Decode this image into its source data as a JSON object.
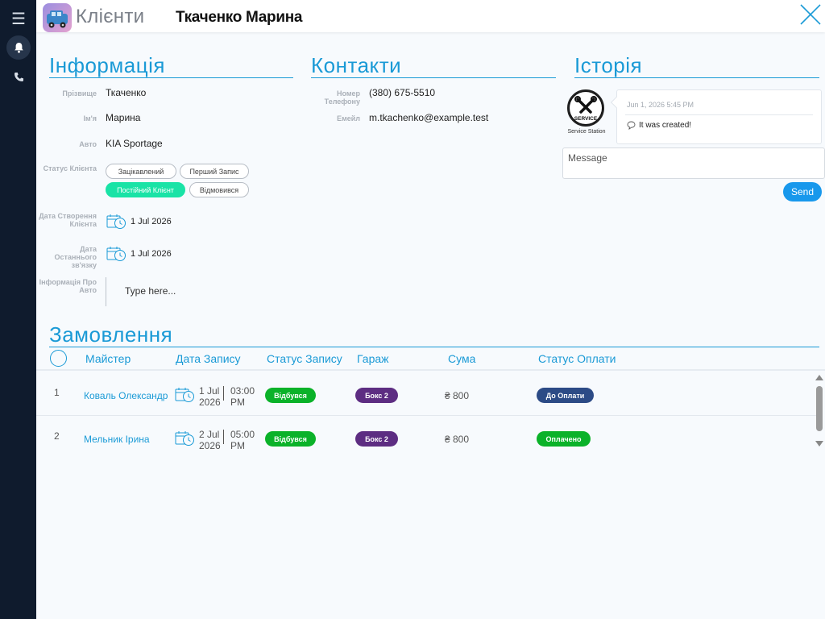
{
  "app": {
    "name": "Клієнти",
    "client_full_name": "Ткаченко Марина"
  },
  "info": {
    "title": "Інформація",
    "surname_label": "Прізвище",
    "surname": "Ткаченко",
    "name_label": "Ім'я",
    "name": "Марина",
    "car_label": "Авто",
    "car": "KIA Sportage",
    "status_label": "Статус Клієнта",
    "statuses": [
      {
        "label": "Зацікавлений",
        "active": false
      },
      {
        "label": "Перший Запис",
        "active": false
      },
      {
        "label": "Постійний Клієнт",
        "active": true
      },
      {
        "label": "Відмовився",
        "active": false
      }
    ],
    "created_label": "Дата Створення Клієнта",
    "created": "1 Jul 2026",
    "last_contact_label": "Дата Останнього зв'язку",
    "last_contact": "1 Jul 2026",
    "car_info_label": "Інформація Про Авто",
    "car_info_placeholder": "Type here..."
  },
  "contacts": {
    "title": "Контакти",
    "phone_label": "Номер Телефону",
    "phone": "(380) 675-5510",
    "email_label": "Емейл",
    "email": "m.tkachenko@example.test"
  },
  "history": {
    "title": "Історія",
    "avatar_text": "SERVICE",
    "avatar_caption": "Service Station",
    "entry_time": "Jun 1, 2026 5:45 PM",
    "entry_text": "It was created!",
    "message_placeholder": "Message",
    "send_label": "Send"
  },
  "orders": {
    "title": "Замовлення",
    "columns": [
      "Майстер",
      "Дата Запису",
      "Статус Запису",
      "Гараж",
      "Сума",
      "Статус Оплати"
    ],
    "rows": [
      {
        "num": "1",
        "master": "Коваль Олександр",
        "date_line1": "1 Jul",
        "date_line2": "2026",
        "time_line1": "03:00",
        "time_line2": "PM",
        "status": "Відбувся",
        "garage": "Бокс 2",
        "sum": "₴ 800",
        "payment": "До Оплати",
        "payment_color": "#2c4b86"
      },
      {
        "num": "2",
        "master": "Мельник Ірина",
        "date_line1": "2 Jul",
        "date_line2": "2026",
        "time_line1": "05:00",
        "time_line2": "PM",
        "status": "Відбувся",
        "garage": "Бокс 2",
        "sum": "₴ 800",
        "payment": "Оплачено",
        "payment_color": "#0bb229"
      }
    ]
  },
  "colors": {
    "accent": "#1a9ad6",
    "sidebar": "#0f1b2d",
    "active_chip": "#19e3a6",
    "status_done": "#0bb229",
    "garage": "#5d2d82"
  }
}
